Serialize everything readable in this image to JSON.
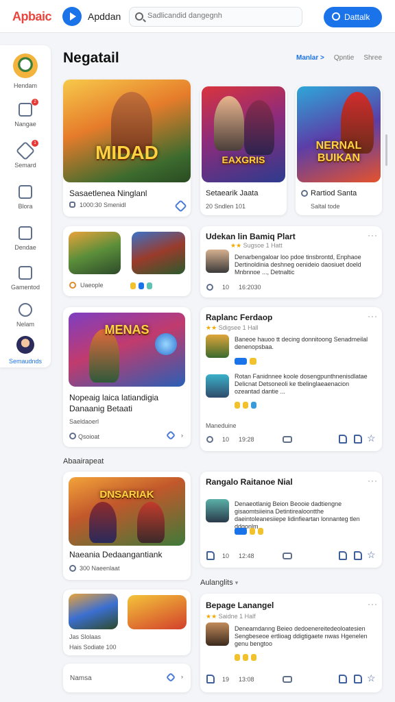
{
  "topbar": {
    "logo": "Apbaic",
    "app_name": "Apddan",
    "search_placeholder": "Sadlicandid dangegnh",
    "account_label": "Dattalk"
  },
  "sidebar": {
    "items": [
      {
        "label": "Hendam",
        "icon": "profile-avatar"
      },
      {
        "label": "Nangae",
        "icon": "home-icon",
        "badge": "2"
      },
      {
        "label": "Semard",
        "icon": "tag-icon",
        "badge": "1"
      },
      {
        "label": "Blora",
        "icon": "book-icon"
      },
      {
        "label": "Dendae",
        "icon": "briefcase-icon"
      },
      {
        "label": "Gamentod",
        "icon": "lock-icon"
      },
      {
        "label": "Nelam",
        "icon": "coin-icon"
      },
      {
        "label": "Semaudnds",
        "icon": "user-avatar"
      }
    ]
  },
  "main": {
    "heading": "Negatail",
    "filters": [
      "Manlar >",
      "Qpntie",
      "Shree"
    ],
    "featured": [
      {
        "art_text": "MIDAD",
        "title": "Sasaetlenea Ninglanl",
        "meta": "1000:30 Smenidl"
      },
      {
        "art_text": "EAXGRIS",
        "title": "Setaearik Jaata",
        "meta": "20 Sndlen 101"
      },
      {
        "art_text": "NERNAL BUIKAN",
        "title": "Rartiod Santa",
        "meta": "Saltal tode"
      }
    ],
    "left_cards": [
      {
        "label": "Uaeople",
        "tags": "D D"
      },
      {
        "art_text": "MENAS",
        "title": "Nopeaig laica latiandigia Danaanig Betaati",
        "subtitle": "Saeldaoerl",
        "footer": "Qsoioat"
      },
      {
        "art_text": "DNSARIAK",
        "title": "Naeania Dedaangantiank",
        "meta": "300 Naeenlaat"
      },
      {
        "text": "Jas Slolaas",
        "meta": "Hais Sodiate 100"
      },
      {
        "footer": "Namsa"
      }
    ],
    "section_left": "Abaairapeat",
    "section_right": "Aulanglits",
    "posts": [
      {
        "title": "Udekan lin Bamiq Plart",
        "rating": "Sugsoe 1 Hatt",
        "body": "Denarbengaloar loo pdoe tinsbrontd, Enphaoe Dertinoldinia deshneg oenideio daosiuet doeld Mnbnnoe ..., Detnaltic",
        "count1": "10",
        "count2": "16:2030"
      },
      {
        "title": "Raplanc Ferdaop",
        "rating": "Sdigsee 1 Hall",
        "entry1": "Baneoe hauoo tt decing donnitoong Senadmeilal denenopsbaa.",
        "entry2": "Rotan Fanidnnee koole dosengpunthnenisdlatae Delicnat Detsoneoli ke tbelinglaeaenacion ozeantad dantie ...",
        "footer": "Maneduine",
        "count1": "10",
        "count2": "19:28"
      },
      {
        "title": "Rangalo Raitanoe Nial",
        "body": "Denaeotlanig Beion Beooie dadtiengne gisaomtsiieina Detintirealoontthe daeintoleanesiiepe lidinfieartan lonnanteg tlen ddgonlm",
        "count1": "10",
        "count2": "12:48"
      },
      {
        "title": "Bepage Lanangel",
        "rating": "Saidne 1 Half",
        "body": "Deneamdanng Beieo dedoenereitedeoloatesien Sengbeseoe ertlioag ddigtigaete nwas Hgenelen genu bengtoo",
        "count1": "19",
        "count2": "13:08"
      }
    ]
  },
  "colors": {
    "accent": "#1a73e8",
    "logo": "#e8453c",
    "badge": "#e53935",
    "rating": "#f2a900"
  }
}
